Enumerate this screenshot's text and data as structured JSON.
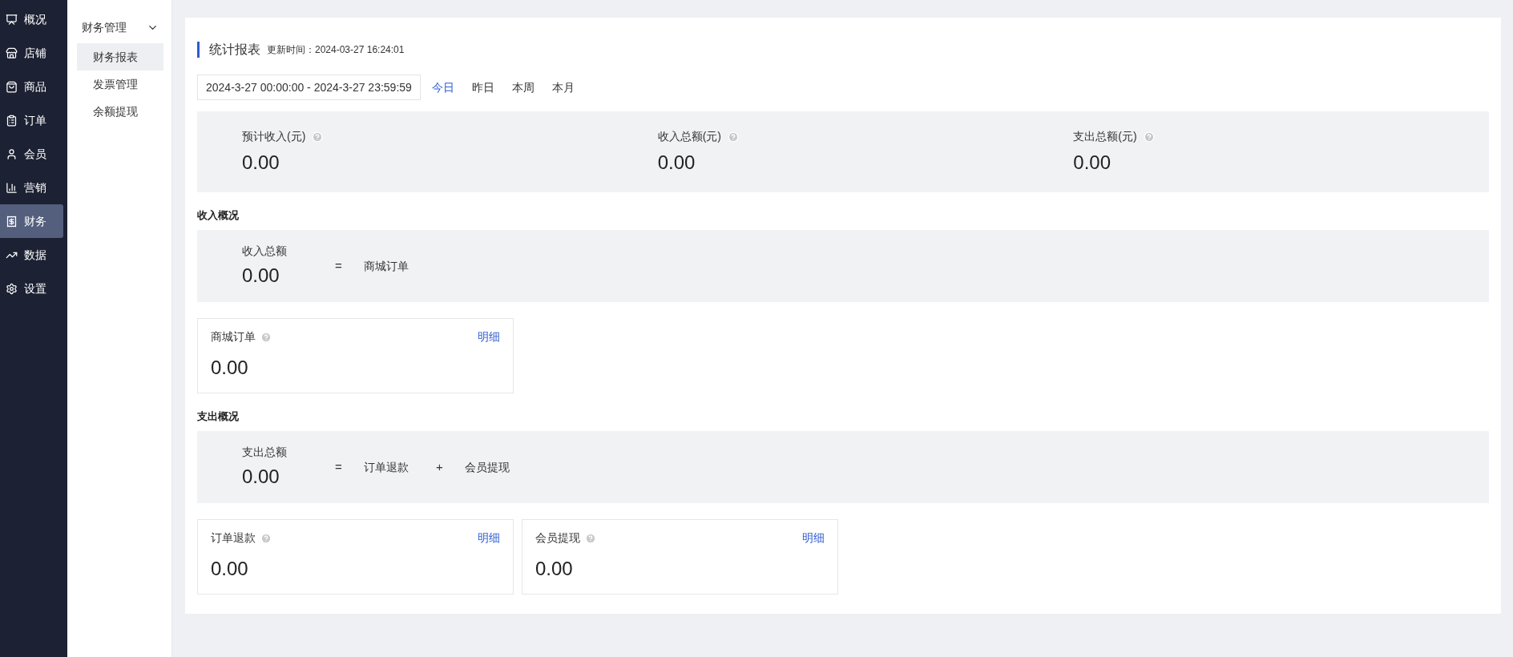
{
  "nav": {
    "items": [
      {
        "label": "概况",
        "selected": false
      },
      {
        "label": "店铺",
        "selected": false
      },
      {
        "label": "商品",
        "selected": false
      },
      {
        "label": "订单",
        "selected": false
      },
      {
        "label": "会员",
        "selected": false
      },
      {
        "label": "营销",
        "selected": false
      },
      {
        "label": "财务",
        "selected": true
      },
      {
        "label": "数据",
        "selected": false
      },
      {
        "label": "设置",
        "selected": false
      }
    ]
  },
  "submenu": {
    "title": "财务管理",
    "expanded": true,
    "items": [
      {
        "label": "财务报表",
        "selected": true
      },
      {
        "label": "发票管理",
        "selected": false
      },
      {
        "label": "余额提现",
        "selected": false
      }
    ]
  },
  "report": {
    "title": "统计报表",
    "update_time": "更新时间：2024-03-27 16:24:01",
    "date_range": "2024-3-27 00:00:00 - 2024-3-27 23:59:59",
    "quick_ranges": [
      {
        "label": "今日",
        "selected": true
      },
      {
        "label": "昨日",
        "selected": false
      },
      {
        "label": "本周",
        "selected": false
      },
      {
        "label": "本月",
        "selected": false
      }
    ],
    "summary": [
      {
        "label": "预计收入(元)",
        "value": "0.00"
      },
      {
        "label": "收入总额(元)",
        "value": "0.00"
      },
      {
        "label": "支出总额(元)",
        "value": "0.00"
      }
    ],
    "sections": [
      {
        "title": "收入概况",
        "formula": [
          {
            "kind": "total",
            "label": "收入总额",
            "value": "0.00"
          },
          {
            "kind": "operator",
            "text": "="
          },
          {
            "kind": "term",
            "text": "商城订单"
          }
        ],
        "cards": [
          {
            "label": "商城订单",
            "value": "0.00",
            "link": "明细"
          }
        ]
      },
      {
        "title": "支出概况",
        "formula": [
          {
            "kind": "total",
            "label": "支出总额",
            "value": "0.00"
          },
          {
            "kind": "operator",
            "text": "="
          },
          {
            "kind": "term",
            "text": "订单退款"
          },
          {
            "kind": "operator",
            "text": "+"
          },
          {
            "kind": "term",
            "text": "会员提现"
          }
        ],
        "cards": [
          {
            "label": "订单退款",
            "value": "0.00",
            "link": "明细"
          },
          {
            "label": "会员提现",
            "value": "0.00",
            "link": "明细"
          }
        ]
      }
    ]
  }
}
